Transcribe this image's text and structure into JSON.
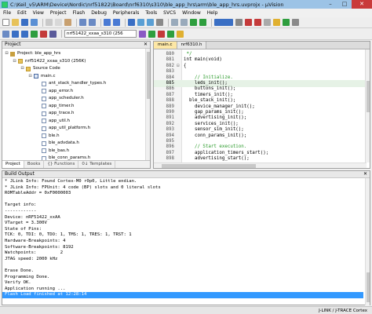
{
  "window": {
    "title": "C:\\Keil_v5\\ARM\\Device\\Nordic\\nrf51822\\Board\\nrf6310\\s310\\ble_app_hrs\\arm\\ble_app_hrs.uvprojx - µVision"
  },
  "menu": [
    "File",
    "Edit",
    "View",
    "Project",
    "Flash",
    "Debug",
    "Peripherals",
    "Tools",
    "SVCS",
    "Window",
    "Help"
  ],
  "toolbar": {
    "target_select": "nrf51422_xxaa_s310 (256",
    "colors": {
      "green": "#2e9e3e",
      "blue": "#3a6fc4",
      "red": "#c43a3a",
      "yellow": "#e0b030",
      "gray": "#8a8a8a"
    }
  },
  "project_panel": {
    "title": "Project",
    "tree": [
      {
        "label": "Project: ble_app_hrs",
        "depth": 0,
        "expander": "⊟",
        "icon": "project-icon"
      },
      {
        "label": "nrf51422_xxaa_s310 (256K)",
        "depth": 1,
        "expander": "⊟",
        "icon": "folder-icon"
      },
      {
        "label": "Source Code",
        "depth": 2,
        "expander": "⊟",
        "icon": "folder-icon"
      },
      {
        "label": "main.c",
        "depth": 3,
        "expander": "⊟",
        "icon": "c-file-icon"
      },
      {
        "label": "ant_stack_handler_types.h",
        "depth": 4,
        "expander": "",
        "icon": "h-file-icon"
      },
      {
        "label": "app_error.h",
        "depth": 4,
        "expander": "",
        "icon": "h-file-icon"
      },
      {
        "label": "app_scheduler.h",
        "depth": 4,
        "expander": "",
        "icon": "h-file-icon"
      },
      {
        "label": "app_timer.h",
        "depth": 4,
        "expander": "",
        "icon": "h-file-icon"
      },
      {
        "label": "app_trace.h",
        "depth": 4,
        "expander": "",
        "icon": "h-file-icon"
      },
      {
        "label": "app_util.h",
        "depth": 4,
        "expander": "",
        "icon": "h-file-icon"
      },
      {
        "label": "app_util_platform.h",
        "depth": 4,
        "expander": "",
        "icon": "h-file-icon"
      },
      {
        "label": "ble.h",
        "depth": 4,
        "expander": "",
        "icon": "h-file-icon"
      },
      {
        "label": "ble_advdata.h",
        "depth": 4,
        "expander": "",
        "icon": "h-file-icon"
      },
      {
        "label": "ble_bas.h",
        "depth": 4,
        "expander": "",
        "icon": "h-file-icon"
      },
      {
        "label": "ble_conn_params.h",
        "depth": 4,
        "expander": "",
        "icon": "h-file-icon"
      }
    ],
    "tabs": [
      "Project",
      "Books",
      "{} Functions",
      "0↓ Templates"
    ]
  },
  "editor": {
    "tabs": [
      {
        "label": "main.c",
        "active": true
      },
      {
        "label": "nrf6310.h",
        "active": false
      }
    ],
    "lines": [
      {
        "n": "880",
        "fold": "",
        "text": " */",
        "kind": "comment"
      },
      {
        "n": "881",
        "fold": "",
        "text": "int main(void)",
        "kind": "code"
      },
      {
        "n": "882",
        "fold": "⊟",
        "text": "{",
        "kind": "code"
      },
      {
        "n": "883",
        "fold": "",
        "text": "",
        "kind": "code"
      },
      {
        "n": "884",
        "fold": "",
        "text": "    // Initialize.",
        "kind": "comment"
      },
      {
        "n": "885",
        "fold": "",
        "text": "    leds_init();",
        "kind": "current"
      },
      {
        "n": "886",
        "fold": "",
        "text": "    buttons_init();",
        "kind": "code"
      },
      {
        "n": "887",
        "fold": "",
        "text": "    timers_init();",
        "kind": "code"
      },
      {
        "n": "888",
        "fold": "",
        "text": "  ble_stack_init();",
        "kind": "code"
      },
      {
        "n": "889",
        "fold": "",
        "text": "    device_manager_init();",
        "kind": "code"
      },
      {
        "n": "890",
        "fold": "",
        "text": "    gap_params_init();",
        "kind": "code"
      },
      {
        "n": "891",
        "fold": "",
        "text": "    advertising_init();",
        "kind": "code"
      },
      {
        "n": "892",
        "fold": "",
        "text": "    services_init();",
        "kind": "code"
      },
      {
        "n": "893",
        "fold": "",
        "text": "    sensor_sim_init();",
        "kind": "code"
      },
      {
        "n": "894",
        "fold": "",
        "text": "    conn_params_init();",
        "kind": "code"
      },
      {
        "n": "895",
        "fold": "",
        "text": "",
        "kind": "code"
      },
      {
        "n": "896",
        "fold": "",
        "text": "    // Start execution.",
        "kind": "comment"
      },
      {
        "n": "897",
        "fold": "",
        "text": "    application_timers_start();",
        "kind": "code"
      },
      {
        "n": "898",
        "fold": "",
        "text": "    advertising_start();",
        "kind": "code"
      }
    ]
  },
  "build_output": {
    "title": "Build Output",
    "lines": [
      "* JLink Info: Found Cortex-M0 r0p0, Little endian.",
      "* JLink Info: FPUnit: 4 code (BP) slots and 0 literal slots",
      "ROMTableAddr = 0xF0000003",
      "",
      "Target info:",
      "------------",
      "Device: nRF51422_xxAA",
      "VTarget = 3.300V",
      "State of Pins:",
      "TCK: 0, TDI: 0, TDO: 1, TMS: 1, TRES: 1, TRST: 1",
      "Hardware-Breakpoints: 4",
      "Software-Breakpoints: 8192",
      "Watchpoints:         2",
      "JTAG speed: 2000 kHz",
      "",
      "Erase Done.",
      "Programming Done.",
      "Verify OK.",
      "Application running ...",
      "Flash Load finished at 12:28:14"
    ]
  },
  "status": {
    "debugger": "J-LINK / J-TRACE Cortex"
  }
}
